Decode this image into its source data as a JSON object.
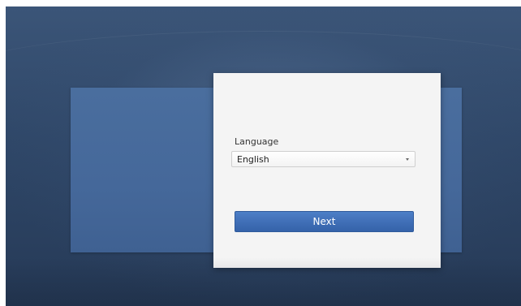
{
  "setup": {
    "language_label": "Language",
    "language_value": "English",
    "next_label": "Next"
  },
  "icons": {
    "select_caret": "chevron-down-icon"
  },
  "colors": {
    "background": "#2f4768",
    "back_panel": "#45689a",
    "dialog": "#f4f4f4",
    "button": "#3f6eb6",
    "button_text": "#ffffff"
  }
}
